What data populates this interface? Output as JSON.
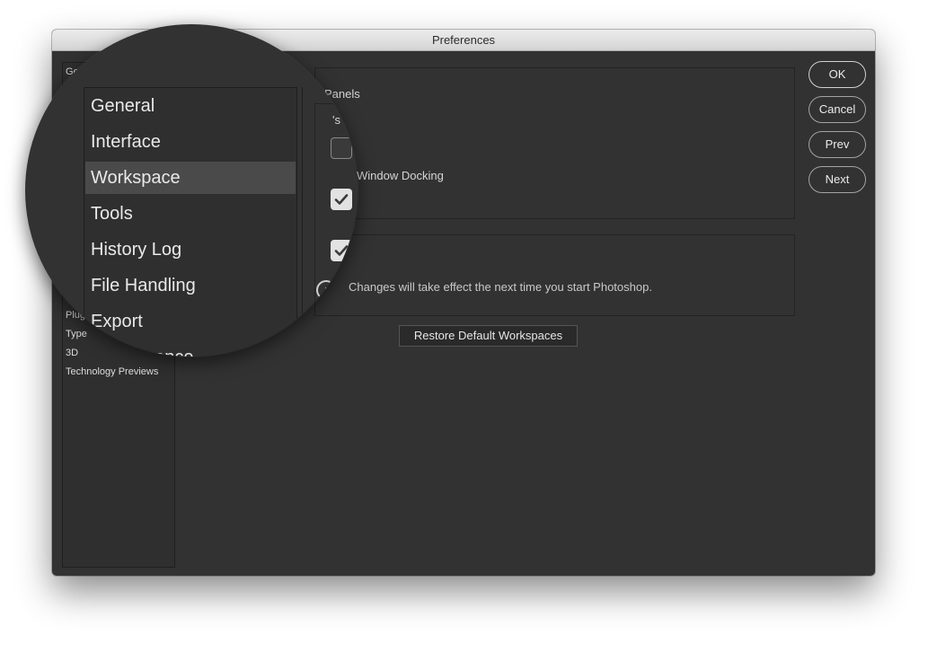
{
  "window": {
    "title": "Preferences"
  },
  "sidebar": {
    "items": [
      {
        "label": "Ge"
      },
      {
        "label": "Plug"
      },
      {
        "label": "Type"
      },
      {
        "label": "3D"
      },
      {
        "label": "Technology Previews"
      }
    ]
  },
  "magnifier": {
    "items": [
      {
        "label": "General"
      },
      {
        "label": "Interface"
      },
      {
        "label": "Workspace",
        "active": true
      },
      {
        "label": "Tools"
      },
      {
        "label": "History Log"
      },
      {
        "label": "File Handling"
      },
      {
        "label": "Export"
      },
      {
        "label": "Performance"
      }
    ],
    "fragment_s": "'s",
    "fragment_ar": "ar"
  },
  "content": {
    "panels_title": "Panels",
    "window_docking": "Window Docking",
    "restart_hint": "Changes will take effect the next time you start Photoshop.",
    "restore_button": "Restore Default Workspaces"
  },
  "buttons": {
    "ok": "OK",
    "cancel": "Cancel",
    "prev": "Prev",
    "next": "Next"
  },
  "icons": {
    "checkmark": "checkmark-icon",
    "info": "info-icon"
  }
}
